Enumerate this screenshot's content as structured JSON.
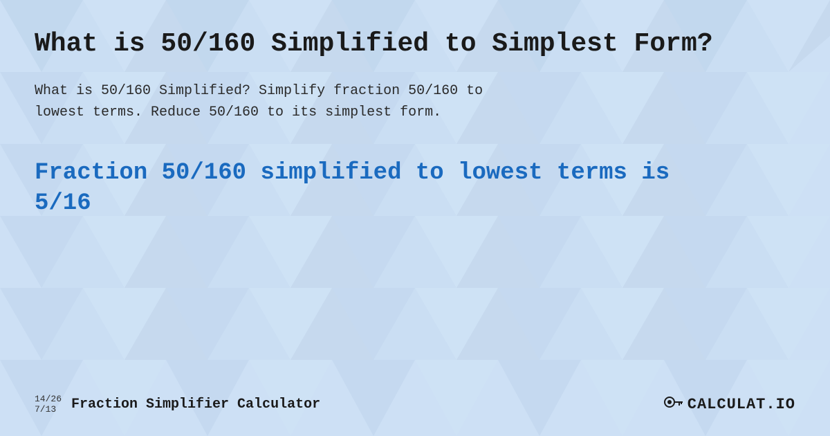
{
  "page": {
    "title": "What is 50/160 Simplified to Simplest Form?",
    "description": "What is 50/160 Simplified?  Simplify fraction 50/160 to\nlowest terms.  Reduce 50/160 to its simplest form.",
    "result_heading": "Fraction 50/160 simplified to lowest terms is\n5/16",
    "background_color": "#c8dff5",
    "pattern_color_light": "#b8d4ef",
    "pattern_color_dark": "#a8c4e0"
  },
  "footer": {
    "fraction1_num": "14/26",
    "fraction1_den": "7/13",
    "site_title": "Fraction Simplifier Calculator",
    "logo_text": "CALCULAT.IO",
    "logo_icon": "🔑"
  }
}
